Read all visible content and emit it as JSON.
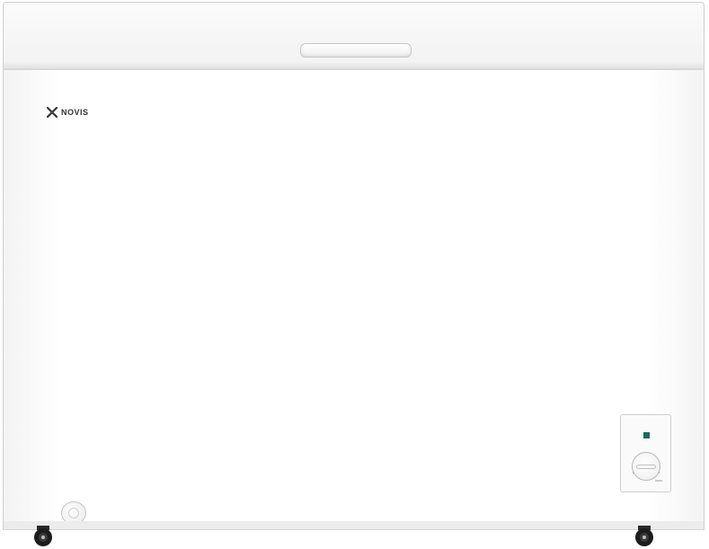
{
  "brand": {
    "name": "NOVIS",
    "icon": "novis-logo-icon"
  },
  "appliance": {
    "type": "chest-freezer",
    "color": "#ffffff"
  },
  "control_panel": {
    "indicator_color": "#1a6b5c",
    "knob_icon": "thermostat-knob-icon"
  },
  "parts": {
    "handle_icon": "lid-handle-icon",
    "drain_icon": "drain-plug-icon",
    "caster_icon": "caster-wheel-icon"
  }
}
